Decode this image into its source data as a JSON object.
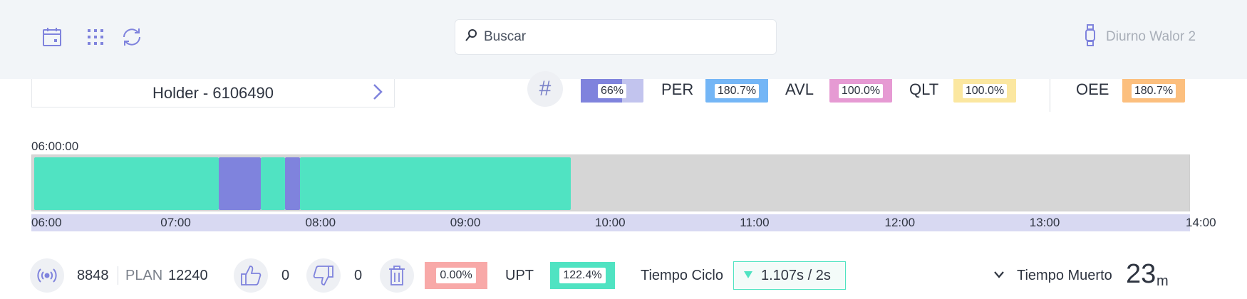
{
  "search": {
    "placeholder": "Buscar",
    "value": ""
  },
  "user": {
    "name": "Diurno Walor 2"
  },
  "holder": {
    "title": "Holder - 6106490"
  },
  "kpis": {
    "hash_value": "66%",
    "hash_fill": 0.66,
    "per_label": "PER",
    "per_value": "180.7%",
    "avl_label": "AVL",
    "avl_value": "100.0%",
    "qlt_label": "QLT",
    "qlt_value": "100.0%",
    "oee_label": "OEE",
    "oee_value": "180.7%"
  },
  "timeline": {
    "start_label": "06:00:00",
    "ticks": [
      "06:00",
      "07:00",
      "08:00",
      "09:00",
      "10:00",
      "11:00",
      "12:00",
      "13:00",
      "14:00"
    ],
    "range_hours": [
      6,
      14
    ],
    "segments": [
      {
        "state": "running",
        "start": 6.0,
        "end": 7.28
      },
      {
        "state": "stopped",
        "start": 7.28,
        "end": 7.57
      },
      {
        "state": "running",
        "start": 7.57,
        "end": 7.74
      },
      {
        "state": "stopped",
        "start": 7.74,
        "end": 7.84
      },
      {
        "state": "running",
        "start": 7.84,
        "end": 9.72
      }
    ],
    "colors": {
      "running": "#50e3c2",
      "stopped": "#7f83dd",
      "empty": "#d6d6d6",
      "axis": "#d8d9f2"
    }
  },
  "production": {
    "count": "8848",
    "plan_label": "PLAN",
    "plan_value": "12240",
    "good": "0",
    "bad": "0",
    "scrap_value": "0.00%",
    "upt_label": "UPT",
    "upt_value": "122.4%",
    "cycle_label": "Tiempo Ciclo",
    "cycle_value": "1.107s  /  2s",
    "dead_label": "Tiempo Muerto",
    "dead_value": "23",
    "dead_unit": "m"
  },
  "colors": {
    "accent": "#7f83dd",
    "per": "#74b6f6",
    "avl": "#e69ad3",
    "qlt": "#fbe7a0",
    "oee": "#fcbf7e",
    "scrap": "#f8a9a8",
    "upt": "#50e3c2"
  },
  "icons": [
    "calendar-icon",
    "grid-icon",
    "refresh-icon",
    "search-icon",
    "watch-icon",
    "chevron-right-icon",
    "hash-icon",
    "signal-icon",
    "thumbs-up-icon",
    "thumbs-down-icon",
    "trash-icon",
    "triangle-down-icon",
    "chevron-down-icon"
  ]
}
